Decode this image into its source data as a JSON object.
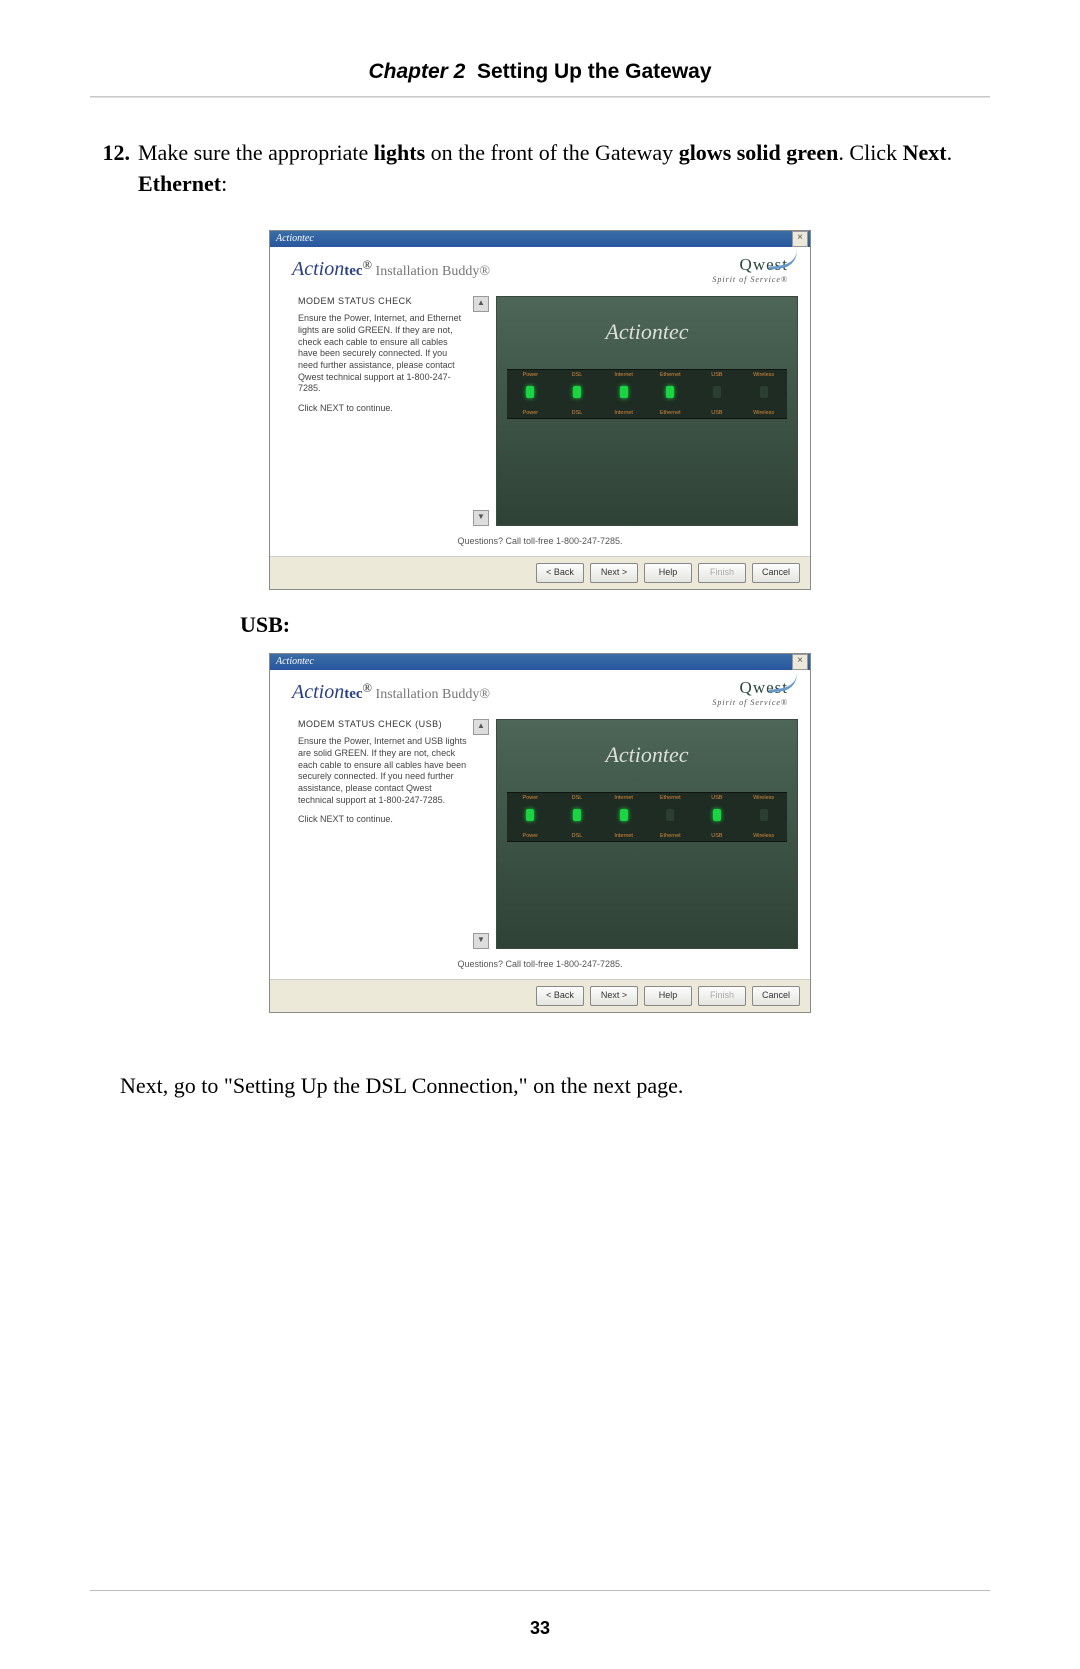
{
  "header": {
    "chapter": "Chapter 2",
    "title": "Setting Up the Gateway"
  },
  "step": {
    "number": "12.",
    "t1": "Make sure the appropriate ",
    "b1": "lights",
    "t2": " on the front of the Gateway ",
    "b2": "glows solid green",
    "t3": ". Click ",
    "b3": "Next",
    "t4": ".",
    "eth_label": "Ethernet",
    "eth_colon": ":"
  },
  "usb_label": "USB:",
  "next_line": "Next, go to \"Setting Up the DSL Connection,\" on the next page.",
  "page_number": "33",
  "dialog": {
    "titlebar": "Actiontec",
    "close": "×",
    "brand": {
      "act": "Action",
      "tec": "tec",
      "reg": "®",
      "inst": " Installation Buddy®"
    },
    "qwest": {
      "name": "Qwest",
      "sos": "Spirit of Service®"
    },
    "ethernet": {
      "heading": "MODEM STATUS CHECK",
      "body": "Ensure the Power, Internet, and Ethernet lights are solid GREEN. If they are not, check each cable to ensure all cables have been securely connected. If you need further assistance, please contact Qwest technical support at 1-800-247-7285.",
      "cont": "Click NEXT to continue."
    },
    "usb": {
      "heading": "MODEM STATUS CHECK (USB)",
      "body": "Ensure the Power, Internet and USB lights are solid GREEN. If they are not, check each cable to ensure all cables have been securely connected. If you need further assistance, please contact Qwest technical support at 1-800-247-7285.",
      "cont": "Click NEXT to continue."
    },
    "modem_logo": "Actiontec",
    "leds": [
      "Power",
      "DSL",
      "Internet",
      "Ethernet",
      "USB",
      "Wireless"
    ],
    "questions": "Questions? Call toll-free 1-800-247-7285.",
    "buttons": {
      "back": "< Back",
      "next": "Next >",
      "help": "Help",
      "finish": "Finish",
      "cancel": "Cancel"
    },
    "scroll_up": "▲",
    "scroll_down": "▼"
  }
}
